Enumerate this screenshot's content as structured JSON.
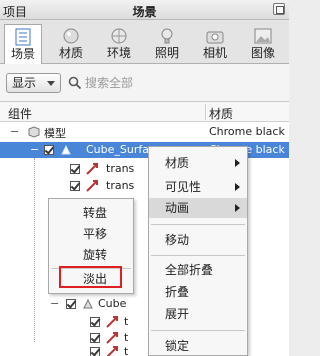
{
  "titlebar": {
    "left": "项目",
    "center": "场景"
  },
  "tabs": [
    {
      "label": "场景",
      "icon": "scene-list-icon",
      "active": true
    },
    {
      "label": "材质",
      "icon": "material-sphere-icon"
    },
    {
      "label": "环境",
      "icon": "environment-globe-icon"
    },
    {
      "label": "照明",
      "icon": "lightbulb-icon"
    },
    {
      "label": "相机",
      "icon": "camera-icon"
    },
    {
      "label": "图像",
      "icon": "image-icon"
    }
  ],
  "toolbar": {
    "show_label": "显示",
    "search_placeholder": "搜索全部"
  },
  "columns": {
    "component": "组件",
    "material": "材质"
  },
  "rows": [
    {
      "name": "模型",
      "material": "Chrome black"
    },
    {
      "name": "Cube_Surface",
      "material": "Chrome black"
    },
    {
      "name": "trans",
      "material": ""
    },
    {
      "name": "trans",
      "material": ""
    },
    {
      "name": "Cube",
      "material": ""
    },
    {
      "name": "t",
      "material": ""
    },
    {
      "name": "t",
      "material": ""
    },
    {
      "name": "t",
      "material": ""
    }
  ],
  "main_menu": {
    "items": [
      "材质",
      "可见性",
      "动画",
      "移动",
      "全部折叠",
      "折叠",
      "展开",
      "锁定"
    ]
  },
  "anim_submenu": {
    "items": [
      "转盘",
      "平移",
      "旋转",
      "淡出"
    ],
    "highlighted": "淡出",
    "highlight_color": "#e02020"
  },
  "colors": {
    "selection": "#4a86d8",
    "accent_red": "#e02020"
  }
}
